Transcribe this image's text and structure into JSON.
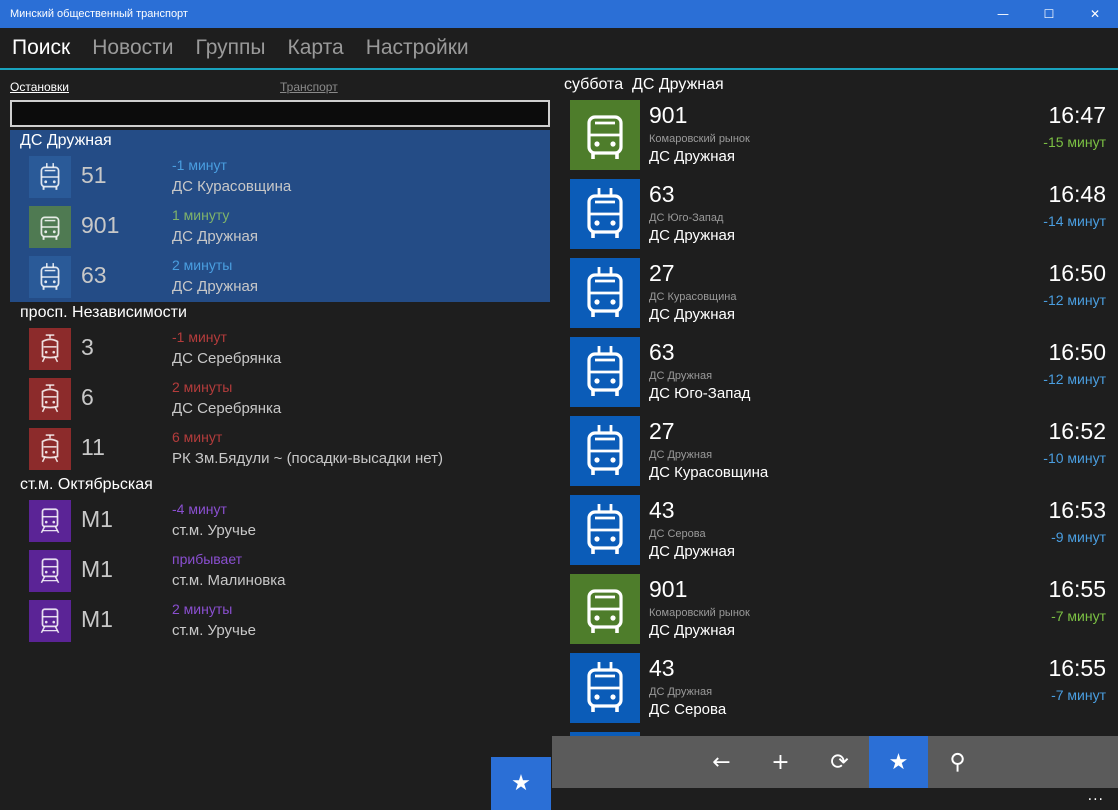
{
  "window": {
    "title": "Минский общественный транспорт",
    "minimize": "—",
    "maximize": "☐",
    "close": "✕"
  },
  "nav": [
    "Поиск",
    "Новости",
    "Группы",
    "Карта",
    "Настройки"
  ],
  "left": {
    "tabs": [
      "Остановки",
      "Транспорт"
    ],
    "search_value": "",
    "groups": [
      {
        "name": "ДС Дружная",
        "selected": true,
        "arrivals": [
          {
            "type": "trolleybus",
            "color": "#2a5a98",
            "route": "51",
            "eta": "-1 минут",
            "eta_color": "#4a9ee0",
            "dest": "ДС Курасовщина"
          },
          {
            "type": "bus",
            "color": "#4f7a52",
            "route": "901",
            "eta": "1 минуту",
            "eta_color": "#7fb36a",
            "dest": "ДС Дружная"
          },
          {
            "type": "trolleybus",
            "color": "#2a5a98",
            "route": "63",
            "eta": "2 минуты",
            "eta_color": "#4a9ee0",
            "dest": "ДС Дружная"
          }
        ]
      },
      {
        "name": "просп. Независимости",
        "selected": false,
        "arrivals": [
          {
            "type": "tram",
            "color": "#8c2b2b",
            "route": "3",
            "eta": "-1 минут",
            "eta_color": "#b43c3c",
            "dest": "ДС Серебрянка"
          },
          {
            "type": "tram",
            "color": "#8c2b2b",
            "route": "6",
            "eta": "2 минуты",
            "eta_color": "#b43c3c",
            "dest": "ДС Серебрянка"
          },
          {
            "type": "tram",
            "color": "#8c2b2b",
            "route": "11",
            "eta": "6 минут",
            "eta_color": "#b43c3c",
            "dest": "РК Зм.Бядули ~ (посадки-высадки нет)"
          }
        ]
      },
      {
        "name": "ст.м. Октябрьская",
        "selected": false,
        "arrivals": [
          {
            "type": "metro",
            "color": "#5b2496",
            "route": "М1",
            "eta": "-4 минут",
            "eta_color": "#8a4fd0",
            "dest": "ст.м. Уручье"
          },
          {
            "type": "metro",
            "color": "#5b2496",
            "route": "М1",
            "eta": "прибывает",
            "eta_color": "#8a4fd0",
            "dest": "ст.м. Малиновка"
          },
          {
            "type": "metro",
            "color": "#5b2496",
            "route": "М1",
            "eta": "2 минуты",
            "eta_color": "#8a4fd0",
            "dest": "ст.м. Уручье"
          }
        ]
      }
    ],
    "fab_icon": "★"
  },
  "right": {
    "day": "суббота",
    "stop": "ДС Дружная",
    "departures": [
      {
        "type": "bus",
        "color": "#4e7d2b",
        "route": "901",
        "from": "Комаровский рынок",
        "to": "ДС Дружная",
        "time": "16:47",
        "delta": "-15 минут",
        "delta_color": "#7bc043"
      },
      {
        "type": "trolleybus",
        "color": "#0b5cb8",
        "route": "63",
        "from": "ДС Юго-Запад",
        "to": "ДС Дружная",
        "time": "16:48",
        "delta": "-14 минут",
        "delta_color": "#4a9ee0"
      },
      {
        "type": "trolleybus",
        "color": "#0b5cb8",
        "route": "27",
        "from": "ДС Курасовщина",
        "to": "ДС Дружная",
        "time": "16:50",
        "delta": "-12 минут",
        "delta_color": "#4a9ee0"
      },
      {
        "type": "trolleybus",
        "color": "#0b5cb8",
        "route": "63",
        "from": "ДС Дружная",
        "to": "ДС Юго-Запад",
        "time": "16:50",
        "delta": "-12 минут",
        "delta_color": "#4a9ee0"
      },
      {
        "type": "trolleybus",
        "color": "#0b5cb8",
        "route": "27",
        "from": "ДС Дружная",
        "to": "ДС Курасовщина",
        "time": "16:52",
        "delta": "-10 минут",
        "delta_color": "#4a9ee0"
      },
      {
        "type": "trolleybus",
        "color": "#0b5cb8",
        "route": "43",
        "from": "ДС Серова",
        "to": "ДС Дружная",
        "time": "16:53",
        "delta": "-9 минут",
        "delta_color": "#4a9ee0"
      },
      {
        "type": "bus",
        "color": "#4e7d2b",
        "route": "901",
        "from": "Комаровский рынок",
        "to": "ДС Дружная",
        "time": "16:55",
        "delta": "-7 минут",
        "delta_color": "#7bc043"
      },
      {
        "type": "trolleybus",
        "color": "#0b5cb8",
        "route": "43",
        "from": "ДС Дружная",
        "to": "ДС Серова",
        "time": "16:55",
        "delta": "-7 минут",
        "delta_color": "#4a9ee0"
      },
      {
        "type": "trolleybus",
        "color": "#0b5cb8",
        "route": "",
        "from": "",
        "to": "",
        "time": "",
        "delta": "",
        "delta_color": "#4a9ee0"
      }
    ]
  },
  "appbar": [
    {
      "name": "back-button",
      "icon": "←",
      "active": false
    },
    {
      "name": "add-button",
      "icon": "+",
      "active": false
    },
    {
      "name": "refresh-button",
      "icon": "⟳",
      "active": false
    },
    {
      "name": "favorite-button",
      "icon": "★",
      "active": true
    },
    {
      "name": "location-button",
      "icon": "⚲",
      "active": false
    }
  ],
  "more": "..."
}
